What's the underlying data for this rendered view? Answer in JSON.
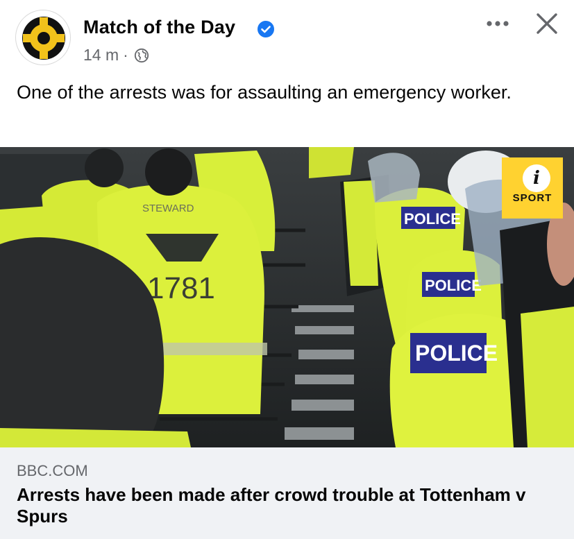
{
  "post": {
    "page_name": "Match of the Day",
    "time": "14 m",
    "separator": "·",
    "caption": "One of the arrests was for assaulting an emergency worker."
  },
  "icons": {
    "verified": "verified-badge-icon",
    "audience": "globe-icon",
    "more": "more-options-icon",
    "close": "close-icon",
    "info": "info-icon"
  },
  "photo": {
    "jacket_number": "1781",
    "steward_text": "STEWARD",
    "police_labels": [
      "POLICE",
      "POLICE",
      "POLICE"
    ],
    "badge_letter": "i",
    "badge_text": "SPORT"
  },
  "link": {
    "domain": "BBC.COM",
    "headline": "Arrests have been made after crowd trouble at Tottenham v Spurs"
  },
  "colors": {
    "verified_blue": "#1877f2",
    "meta_gray": "#65676b",
    "footer_bg": "#f0f2f5",
    "hi_vis_yellow": "#d8ef3a",
    "badge_yellow": "#ffd230"
  }
}
